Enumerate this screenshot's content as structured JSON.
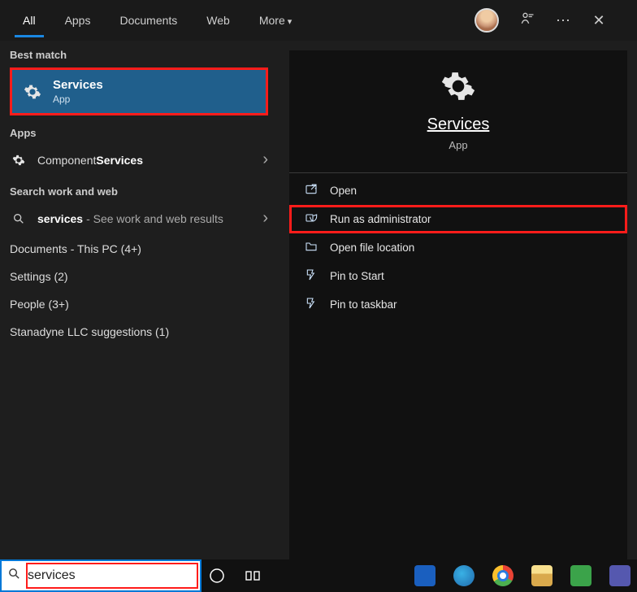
{
  "tabs": {
    "all": "All",
    "apps": "Apps",
    "documents": "Documents",
    "web": "Web",
    "more": "More"
  },
  "left": {
    "best_match_label": "Best match",
    "bm_title": "Services",
    "bm_sub": "App",
    "apps_label": "Apps",
    "comp_svc_prefix": "Component ",
    "comp_svc_bold": "Services",
    "work_web_label": "Search work and web",
    "svc_bold": "services",
    "svc_dim": " - See work and web results",
    "docs": "Documents - This PC (4+)",
    "settings": "Settings (2)",
    "people": "People (3+)",
    "stan": "Stanadyne LLC suggestions (1)"
  },
  "detail": {
    "title": "Services",
    "sub": "App",
    "actions": {
      "open": "Open",
      "admin": "Run as administrator",
      "loc": "Open file location",
      "pinstart": "Pin to Start",
      "pintask": "Pin to taskbar"
    }
  },
  "search": {
    "value": "services"
  }
}
